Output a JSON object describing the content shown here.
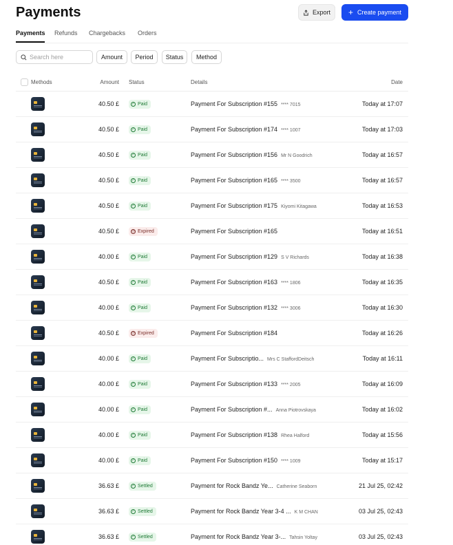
{
  "header": {
    "title": "Payments",
    "export_label": "Export",
    "create_label": "Create payment"
  },
  "tabs": [
    {
      "label": "Payments",
      "active": true
    },
    {
      "label": "Refunds",
      "active": false
    },
    {
      "label": "Chargebacks",
      "active": false
    },
    {
      "label": "Orders",
      "active": false
    }
  ],
  "filters": {
    "search_placeholder": "Search here",
    "chips": [
      "Amount",
      "Period",
      "Status",
      "Method"
    ]
  },
  "table": {
    "columns": {
      "methods": "Methods",
      "amount": "Amount",
      "status": "Status",
      "details": "Details",
      "date": "Date"
    },
    "rows": [
      {
        "amount": "40.50 £",
        "status": "Paid",
        "kind": "paid",
        "title": "Payment For Subscription #155",
        "sub": "**** 7015",
        "date": "Today at 17:07"
      },
      {
        "amount": "40.50 £",
        "status": "Paid",
        "kind": "paid",
        "title": "Payment For Subscription #174",
        "sub": "**** 1007",
        "date": "Today at 17:03"
      },
      {
        "amount": "40.50 £",
        "status": "Paid",
        "kind": "paid",
        "title": "Payment For Subscription #156",
        "sub": "Mr N Goodrich",
        "date": "Today at 16:57"
      },
      {
        "amount": "40.50 £",
        "status": "Paid",
        "kind": "paid",
        "title": "Payment For Subscription #165",
        "sub": "**** 3500",
        "date": "Today at 16:57"
      },
      {
        "amount": "40.50 £",
        "status": "Paid",
        "kind": "paid",
        "title": "Payment For Subscription #175",
        "sub": "Kiyomi Kitagawa",
        "date": "Today at 16:53"
      },
      {
        "amount": "40.50 £",
        "status": "Expired",
        "kind": "expired",
        "title": "Payment For Subscription #165",
        "sub": "",
        "date": "Today at 16:51"
      },
      {
        "amount": "40.00 £",
        "status": "Paid",
        "kind": "paid",
        "title": "Payment For Subscription #129",
        "sub": "S V Richards",
        "date": "Today at 16:38"
      },
      {
        "amount": "40.50 £",
        "status": "Paid",
        "kind": "paid",
        "title": "Payment For Subscription #163",
        "sub": "**** 1806",
        "date": "Today at 16:35"
      },
      {
        "amount": "40.00 £",
        "status": "Paid",
        "kind": "paid",
        "title": "Payment For Subscription #132",
        "sub": "**** 3006",
        "date": "Today at 16:30"
      },
      {
        "amount": "40.50 £",
        "status": "Expired",
        "kind": "expired",
        "title": "Payment For Subscription #184",
        "sub": "",
        "date": "Today at 16:26"
      },
      {
        "amount": "40.00 £",
        "status": "Paid",
        "kind": "paid",
        "title": "Payment For Subscriptio...",
        "sub": "Mrs C StaffordDeitsch",
        "date": "Today at 16:11"
      },
      {
        "amount": "40.00 £",
        "status": "Paid",
        "kind": "paid",
        "title": "Payment For Subscription #133",
        "sub": "**** 2005",
        "date": "Today at 16:09"
      },
      {
        "amount": "40.00 £",
        "status": "Paid",
        "kind": "paid",
        "title": "Payment For Subscription #...",
        "sub": "Anna Piotrovskaya",
        "date": "Today at 16:02"
      },
      {
        "amount": "40.00 £",
        "status": "Paid",
        "kind": "paid",
        "title": "Payment For Subscription #138",
        "sub": "Rhea Halford",
        "date": "Today at 15:56"
      },
      {
        "amount": "40.00 £",
        "status": "Paid",
        "kind": "paid",
        "title": "Payment For Subscription #150",
        "sub": "**** 1009",
        "date": "Today at 15:17"
      },
      {
        "amount": "36.63 £",
        "status": "Settled",
        "kind": "settled",
        "title": "Payment for Rock Bandz Ye...",
        "sub": "Catherine Seaborn",
        "date": "21 Jul 25, 02:42"
      },
      {
        "amount": "36.63 £",
        "status": "Settled",
        "kind": "settled",
        "title": "Payment for Rock Bandz Year 3-4 ...",
        "sub": "K M CHAN",
        "date": "03 Jul 25, 02:43"
      },
      {
        "amount": "36.63 £",
        "status": "Settled",
        "kind": "settled",
        "title": "Payment for Rock Bandz Year 3-...",
        "sub": "Tahsin Yoltay",
        "date": "03 Jul 25, 02:43"
      }
    ]
  },
  "colors": {
    "accent": "#1a4cf0",
    "paid_bg": "#e6f6e9",
    "paid_fg": "#1e7a35",
    "expired_bg": "#fbeceb",
    "expired_fg": "#7a2e2a"
  }
}
